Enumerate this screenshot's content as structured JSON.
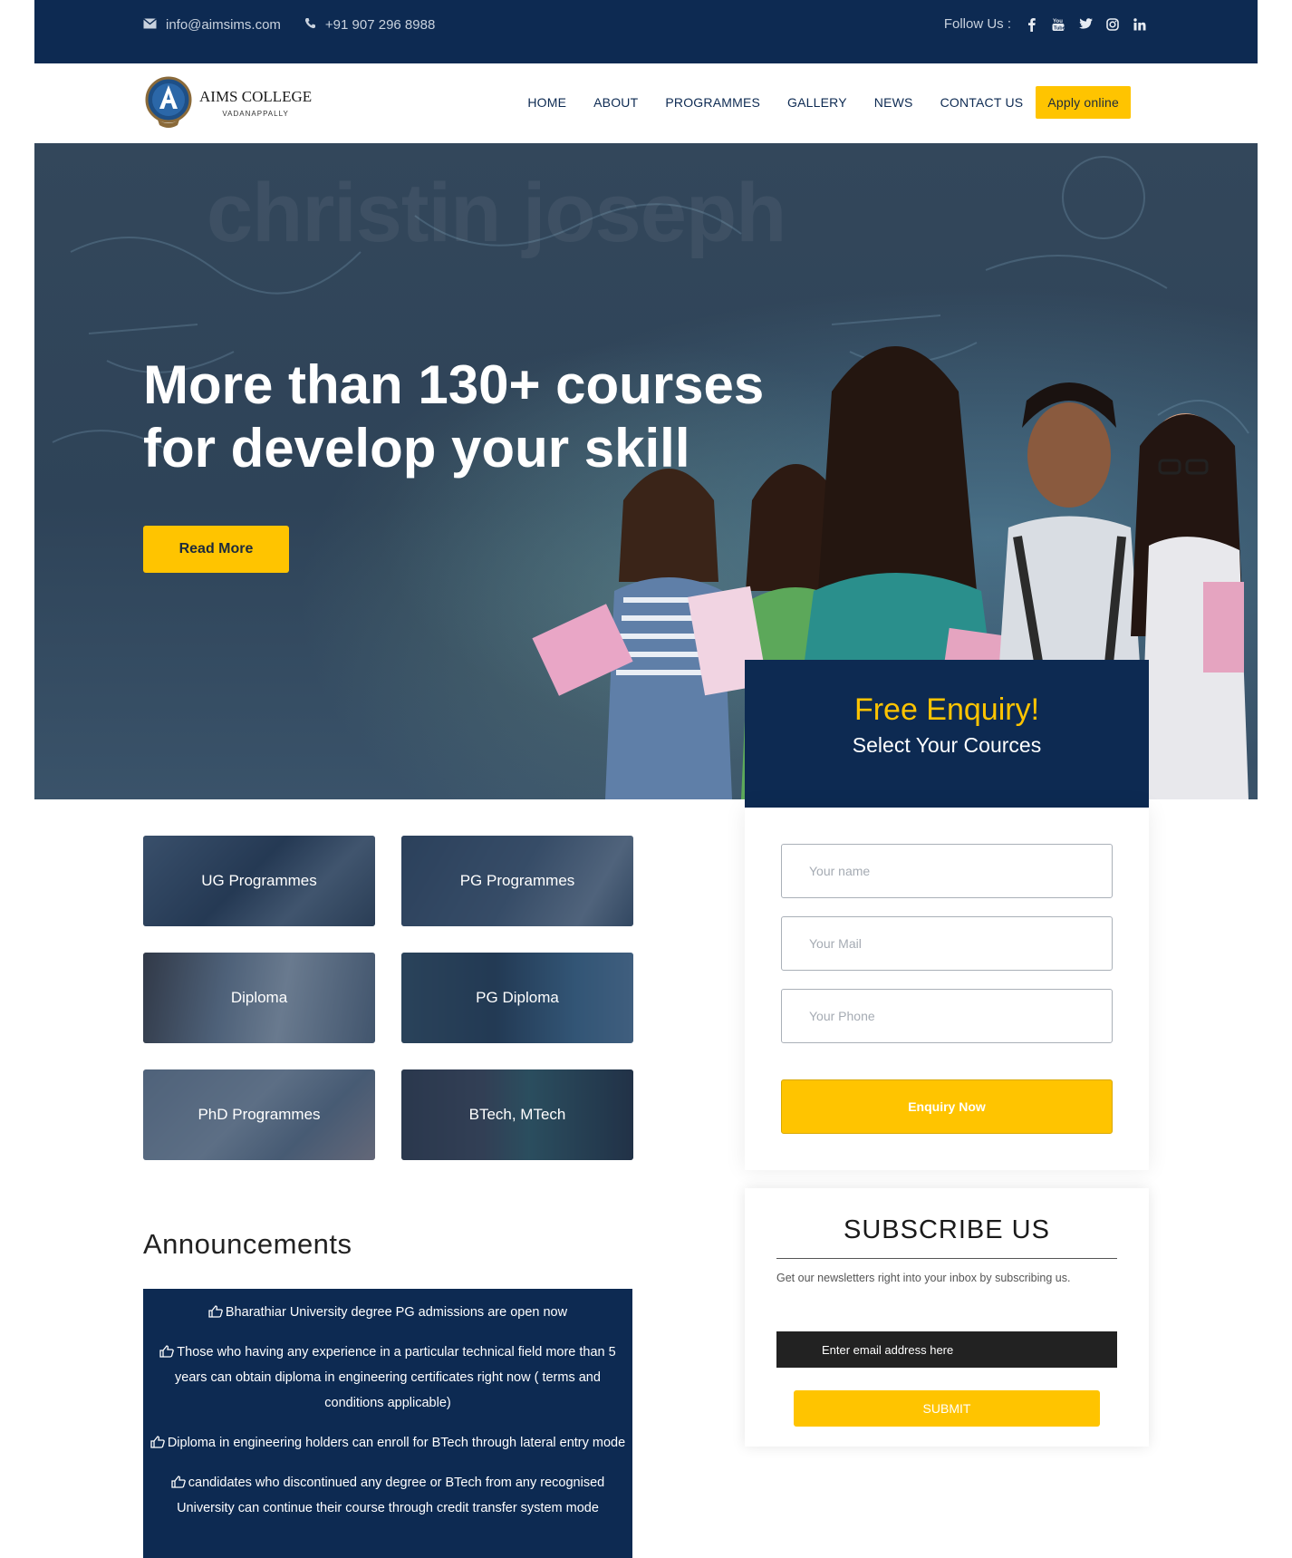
{
  "topbar": {
    "email": "info@aimsims.com",
    "phone": "+91 907 296 8988",
    "follow_label": "Follow Us :",
    "social_icons": [
      "facebook-icon",
      "youtube-icon",
      "twitter-icon",
      "instagram-icon",
      "linkedin-icon"
    ]
  },
  "brand": {
    "name": "AIMS COLLEGE",
    "location": "VADANAPPALLY"
  },
  "nav": {
    "items": [
      "HOME",
      "ABOUT",
      "PROGRAMMES",
      "GALLERY",
      "NEWS",
      "CONTACT US"
    ],
    "apply_label": "Apply online"
  },
  "hero": {
    "watermark": "christin joseph",
    "headline_line1": "More than 130+ courses",
    "headline_line2": "for develop your skill",
    "button_label": "Read More"
  },
  "enquiry": {
    "title": "Free Enquiry!",
    "subtitle": "Select Your Cources",
    "name_placeholder": "Your name",
    "mail_placeholder": "Your Mail",
    "phone_placeholder": "Your Phone",
    "button_label": "Enquiry Now"
  },
  "programmes": [
    "UG Programmes",
    "PG Programmes",
    "Diploma",
    "PG Diploma",
    "PhD Programmes",
    "BTech, MTech"
  ],
  "subscribe": {
    "title": "SUBSCRIBE US",
    "description": "Get our newsletters right into your inbox by subscribing us.",
    "email_placeholder": "Enter email address here",
    "button_label": "SUBMIT"
  },
  "announcements": {
    "title": "Announcements",
    "items": [
      "Bharathiar University degree PG admissions are open now",
      "Those who having any experience in a particular technical field more than 5 years can obtain diploma in engineering certificates right now ( terms and conditions applicable)",
      "Diploma in engineering holders can enroll for BTech through lateral entry mode",
      "candidates who discontinued any degree or BTech from any recognised University can continue their course through credit transfer system mode"
    ]
  },
  "colors": {
    "navy": "#0d2a52",
    "accent": "#ffc400"
  }
}
